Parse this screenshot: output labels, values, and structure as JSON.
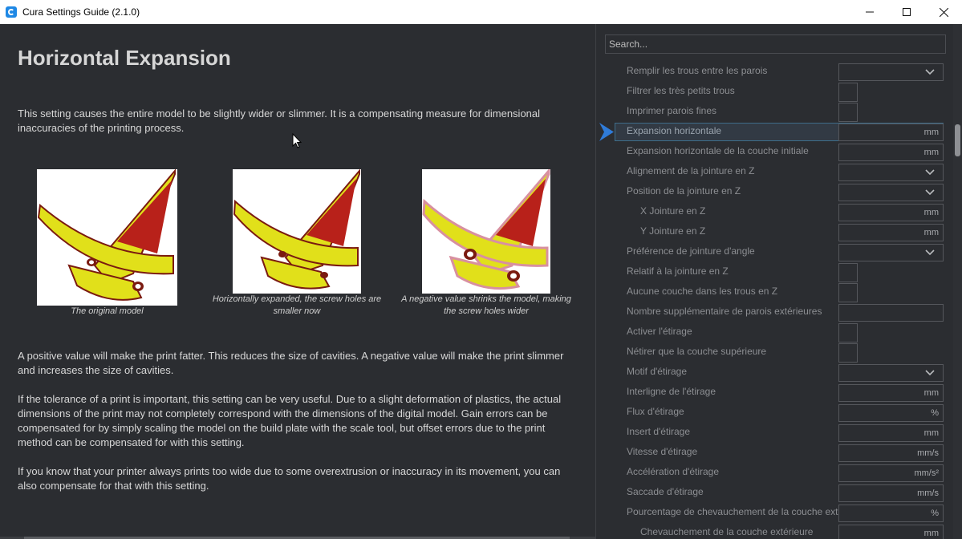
{
  "window": {
    "title": "Cura Settings Guide (2.1.0)",
    "minimize": "—",
    "maximize": "☐",
    "close": "✕"
  },
  "main": {
    "heading": "Horizontal Expansion",
    "intro": "This setting causes the entire model to be slightly wider or slimmer. It is a compensating measure for dimensional inaccuracies of the printing process.",
    "figures": [
      {
        "caption": "The original model"
      },
      {
        "caption": "Horizontally expanded, the screw holes are smaller now"
      },
      {
        "caption": "A negative value shrinks the model, making the screw holes wider"
      }
    ],
    "para1": "A positive value will make the print fatter. This reduces the size of cavities. A negative value will make the print slimmer and increases the size of cavities.",
    "para2": "If the tolerance of a print is important, this setting can be very useful. Due to a slight deformation of plastics, the actual dimensions of the print may not completely correspond with the dimensions of the digital model. Gain errors can be compensated for by simply scaling the model on the build plate with the scale tool, but offset errors due to the print method can be compensated for with this setting.",
    "para3": "If you know that your printer always prints too wide due to some overextrusion or inaccuracy in its movement, you can also compensate for that with this setting."
  },
  "sidebar": {
    "search_placeholder": "Search...",
    "settings": [
      {
        "label": "Remplir les trous entre les parois",
        "control": "dropdown",
        "unit": ""
      },
      {
        "label": "Filtrer les très petits trous",
        "control": "checkbox",
        "unit": ""
      },
      {
        "label": "Imprimer parois fines",
        "control": "checkbox",
        "unit": ""
      },
      {
        "label": "Expansion horizontale",
        "control": "field",
        "unit": "mm",
        "active": true
      },
      {
        "label": "Expansion horizontale de la couche initiale",
        "control": "field",
        "unit": "mm"
      },
      {
        "label": "Alignement de la jointure en Z",
        "control": "dropdown",
        "unit": ""
      },
      {
        "label": "Position de la jointure en Z",
        "control": "dropdown",
        "unit": ""
      },
      {
        "label": "X Jointure en Z",
        "control": "field",
        "unit": "mm",
        "indent": true
      },
      {
        "label": "Y Jointure en Z",
        "control": "field",
        "unit": "mm",
        "indent": true
      },
      {
        "label": "Préférence de jointure d'angle",
        "control": "dropdown",
        "unit": ""
      },
      {
        "label": "Relatif à la jointure en Z",
        "control": "checkbox",
        "unit": ""
      },
      {
        "label": "Aucune couche dans les trous en Z",
        "control": "checkbox",
        "unit": ""
      },
      {
        "label": "Nombre supplémentaire de parois extérieures",
        "control": "field",
        "unit": ""
      },
      {
        "label": "Activer l'étirage",
        "control": "checkbox",
        "unit": ""
      },
      {
        "label": "Nétirer que la couche supérieure",
        "control": "checkbox",
        "unit": ""
      },
      {
        "label": "Motif d'étirage",
        "control": "dropdown",
        "unit": ""
      },
      {
        "label": "Interligne de l'étirage",
        "control": "field",
        "unit": "mm"
      },
      {
        "label": "Flux d'étirage",
        "control": "field",
        "unit": "%"
      },
      {
        "label": "Insert d'étirage",
        "control": "field",
        "unit": "mm"
      },
      {
        "label": "Vitesse d'étirage",
        "control": "field",
        "unit": "mm/s"
      },
      {
        "label": "Accélération d'étirage",
        "control": "field",
        "unit": "mm/s²"
      },
      {
        "label": "Saccade d'étirage",
        "control": "field",
        "unit": "mm/s"
      },
      {
        "label": "Pourcentage de chevauchement de la couche extér",
        "control": "field",
        "unit": "%"
      },
      {
        "label": "Chevauchement de la couche extérieure",
        "control": "field",
        "unit": "mm",
        "indent": true
      }
    ]
  }
}
